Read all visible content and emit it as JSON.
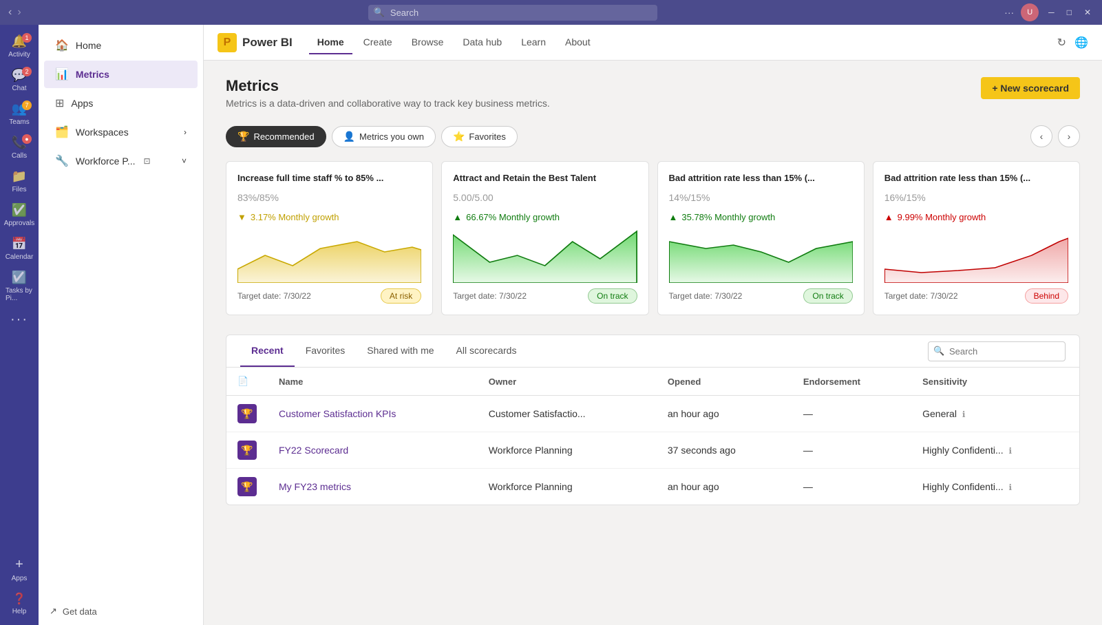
{
  "titlebar": {
    "search_placeholder": "Search"
  },
  "rail": {
    "items": [
      {
        "name": "Activity",
        "icon": "🔔",
        "badge": "1",
        "badge_color": "red"
      },
      {
        "name": "Chat",
        "icon": "💬",
        "badge": "2",
        "badge_color": "red"
      },
      {
        "name": "Teams",
        "icon": "👥",
        "badge": "7",
        "badge_color": "red"
      },
      {
        "name": "Calls",
        "icon": "📞",
        "badge": null
      },
      {
        "name": "Files",
        "icon": "📁",
        "badge": null
      },
      {
        "name": "Approvals",
        "icon": "✅",
        "badge": null
      },
      {
        "name": "Calendar",
        "icon": "📅",
        "badge": null
      },
      {
        "name": "Tasks by Pi...",
        "icon": "☑️",
        "badge": null
      },
      {
        "name": "...",
        "icon": "···",
        "badge": null
      }
    ],
    "bottom": [
      {
        "name": "Apps",
        "icon": "＋"
      },
      {
        "name": "Help",
        "icon": "❓"
      }
    ]
  },
  "sidebar": {
    "items": [
      {
        "name": "Home",
        "icon": "🏠",
        "active": false
      },
      {
        "name": "Metrics",
        "icon": "📊",
        "active": true
      },
      {
        "name": "Apps",
        "icon": "⊞",
        "active": false
      },
      {
        "name": "Workspaces",
        "icon": "🗂️",
        "active": false,
        "chevron": true
      },
      {
        "name": "Workforce P...",
        "icon": "🔧",
        "active": false,
        "chevron": true,
        "extra_icon": true
      }
    ],
    "footer": {
      "label": "Get data",
      "icon": "↗"
    }
  },
  "topnav": {
    "logo_text": "Power BI",
    "links": [
      {
        "label": "Home",
        "active": true
      },
      {
        "label": "Create",
        "active": false
      },
      {
        "label": "Browse",
        "active": false
      },
      {
        "label": "Data hub",
        "active": false
      },
      {
        "label": "Learn",
        "active": false
      },
      {
        "label": "About",
        "active": false
      }
    ]
  },
  "content": {
    "title": "Metrics",
    "subtitle": "Metrics is a data-driven and collaborative way to track key business metrics.",
    "new_scorecard_btn": "+ New scorecard"
  },
  "filter_tabs": [
    {
      "label": "Recommended",
      "icon": "🏆",
      "active": true
    },
    {
      "label": "Metrics you own",
      "icon": "👤",
      "active": false
    },
    {
      "label": "Favorites",
      "icon": "⭐",
      "active": false
    }
  ],
  "metric_cards": [
    {
      "title": "Increase full time staff % to 85% ...",
      "value": "83%",
      "target": "/85%",
      "growth_icon": "▼",
      "growth_type": "down",
      "growth_text": "3.17% Monthly growth",
      "chart_type": "area_yellow",
      "target_date": "Target date: 7/30/22",
      "status": "At risk",
      "status_type": "at-risk"
    },
    {
      "title": "Attract and Retain the Best Talent",
      "value": "5.00",
      "target": "/5.00",
      "growth_icon": "▲",
      "growth_type": "up",
      "growth_text": "66.67% Monthly growth",
      "chart_type": "area_green",
      "target_date": "Target date: 7/30/22",
      "status": "On track",
      "status_type": "on-track"
    },
    {
      "title": "Bad attrition rate less than 15% (...",
      "value": "14%",
      "target": "/15%",
      "growth_icon": "▲",
      "growth_type": "up",
      "growth_text": "35.78% Monthly growth",
      "chart_type": "area_green2",
      "target_date": "Target date: 7/30/22",
      "status": "On track",
      "status_type": "on-track"
    },
    {
      "title": "Bad attrition rate less than 15% (...",
      "value": "16%",
      "target": "/15%",
      "growth_icon": "▲",
      "growth_type": "up-red",
      "growth_text": "9.99% Monthly growth",
      "chart_type": "area_red",
      "target_date": "Target date: 7/30/22",
      "status": "Behind",
      "status_type": "behind"
    }
  ],
  "scorecard_tabs": [
    {
      "label": "Recent",
      "active": true
    },
    {
      "label": "Favorites",
      "active": false
    },
    {
      "label": "Shared with me",
      "active": false
    },
    {
      "label": "All scorecards",
      "active": false
    }
  ],
  "scorecards_search": {
    "placeholder": "Search"
  },
  "table": {
    "headers": [
      "Name",
      "Owner",
      "Opened",
      "Endorsement",
      "Sensitivity"
    ],
    "rows": [
      {
        "name": "Customer Satisfaction KPIs",
        "owner": "Customer Satisfactio...",
        "opened": "an hour ago",
        "endorsement": "—",
        "sensitivity": "General",
        "sensitivity_info": true
      },
      {
        "name": "FY22 Scorecard",
        "owner": "Workforce Planning",
        "opened": "37 seconds ago",
        "endorsement": "—",
        "sensitivity": "Highly Confidenti...",
        "sensitivity_info": true
      },
      {
        "name": "My FY23 metrics",
        "owner": "Workforce Planning",
        "opened": "an hour ago",
        "endorsement": "—",
        "sensitivity": "Highly Confidenti...",
        "sensitivity_info": true
      }
    ]
  }
}
